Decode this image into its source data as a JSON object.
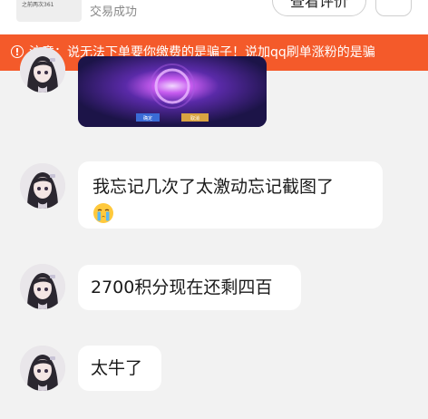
{
  "header": {
    "thumbnail_text": "之前两次361",
    "trade_status": "交易成功",
    "review_button": "查看评价",
    "more_icon": "chevron-down-icon"
  },
  "warning": {
    "icon": "warning-circle-icon",
    "text": "注意：说无法下单要你缴费的是骗子！说加qq刷单涨粉的是骗"
  },
  "image_message": {
    "button_left": "确定",
    "button_right": "取消"
  },
  "messages": [
    {
      "text": "我忘记几次了太激动忘记截图了",
      "emoji": "crying-face-emoji"
    },
    {
      "text": "2700积分现在还剩四百"
    },
    {
      "text": "太牛了"
    }
  ],
  "colors": {
    "banner_bg": "#f45a2a",
    "chat_bg": "#f2f2f2",
    "bubble_bg": "#ffffff"
  }
}
